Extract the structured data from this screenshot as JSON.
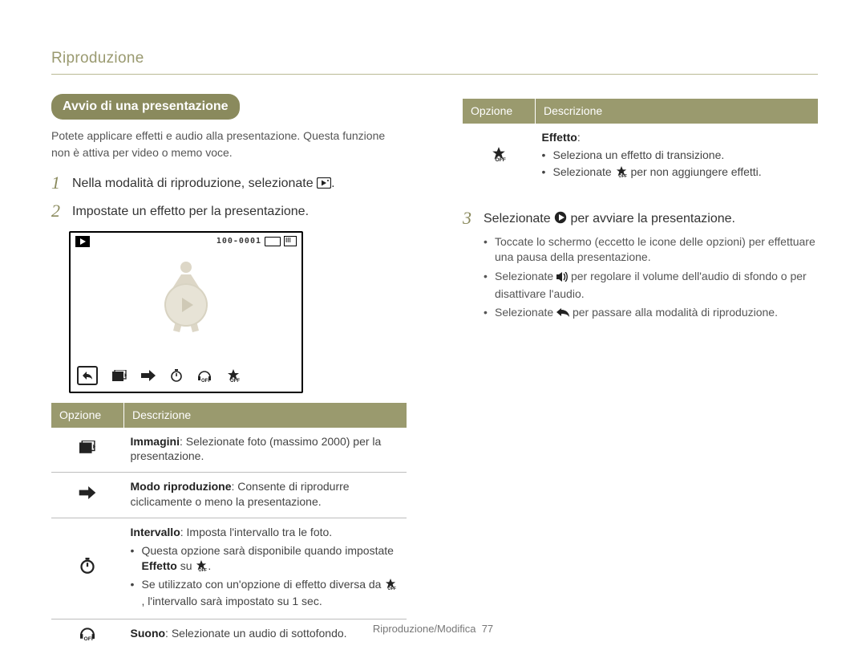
{
  "chapter": "Riproduzione",
  "intro_heading": "Avvio di una presentazione",
  "intro_text": "Potete applicare effetti e audio alla presentazione. Questa funzione non è attiva per video o memo voce.",
  "steps_left": [
    {
      "num": "1",
      "text": "Nella modalità di riproduzione, selezionate ",
      "trailing_icon": "slideshow-box-icon",
      "end": "."
    },
    {
      "num": "2",
      "text": "Impostate un effetto per la presentazione."
    }
  ],
  "screen": {
    "file_counter": "100-0001"
  },
  "table_left": {
    "headers": [
      "Opzione",
      "Descrizione"
    ],
    "rows": [
      {
        "icon": "images-icon",
        "desc_bold": "Immagini",
        "desc_rest": ": Selezionate foto (massimo 2000) per la presentazione."
      },
      {
        "icon": "arrow-right-icon",
        "desc_bold": "Modo riproduzione",
        "desc_rest": ": Consente di riprodurre ciclicamente o meno la presentazione."
      },
      {
        "icon": "stopwatch-icon",
        "desc_bold": "Intervallo",
        "desc_rest": ": Imposta l'intervallo tra le foto.",
        "subs": [
          {
            "pre": "Questa opzione sarà disponibile quando impostate ",
            "bold": "Effetto",
            "mid": " su ",
            "icon": "star-off-icon",
            "post": "."
          },
          {
            "pre": "Se utilizzato con un'opzione di effetto diversa da ",
            "icon": "star-off-icon",
            "post": ", l'intervallo sarà impostato su 1 sec."
          }
        ]
      },
      {
        "icon": "headphones-off-icon",
        "desc_bold": "Suono",
        "desc_rest": ": Selezionate un audio di sottofondo."
      }
    ]
  },
  "table_right": {
    "headers": [
      "Opzione",
      "Descrizione"
    ],
    "row": {
      "icon": "star-off-icon",
      "desc_bold": "Effetto",
      "desc_rest": ":",
      "subs": [
        "Seleziona un effetto di transizione.",
        {
          "pre": "Selezionate ",
          "icon": "star-off-icon",
          "post": " per non aggiungere effetti."
        }
      ]
    }
  },
  "step_right": {
    "num": "3",
    "pre": "Selezionate ",
    "icon": "play-circle-icon",
    "post": " per avviare la presentazione.",
    "subs": [
      "Toccate lo schermo (eccetto le icone delle opzioni) per effettuare una pausa della presentazione.",
      {
        "pre": "Selezionate ",
        "icon": "speaker-icon",
        "post": " per regolare il volume dell'audio di sfondo o per disattivare l'audio."
      },
      {
        "pre": "Selezionate ",
        "icon": "return-arrow-icon",
        "post": " per passare alla modalità di riproduzione."
      }
    ]
  },
  "footer": {
    "section": "Riproduzione/Modifica",
    "page": "77"
  }
}
